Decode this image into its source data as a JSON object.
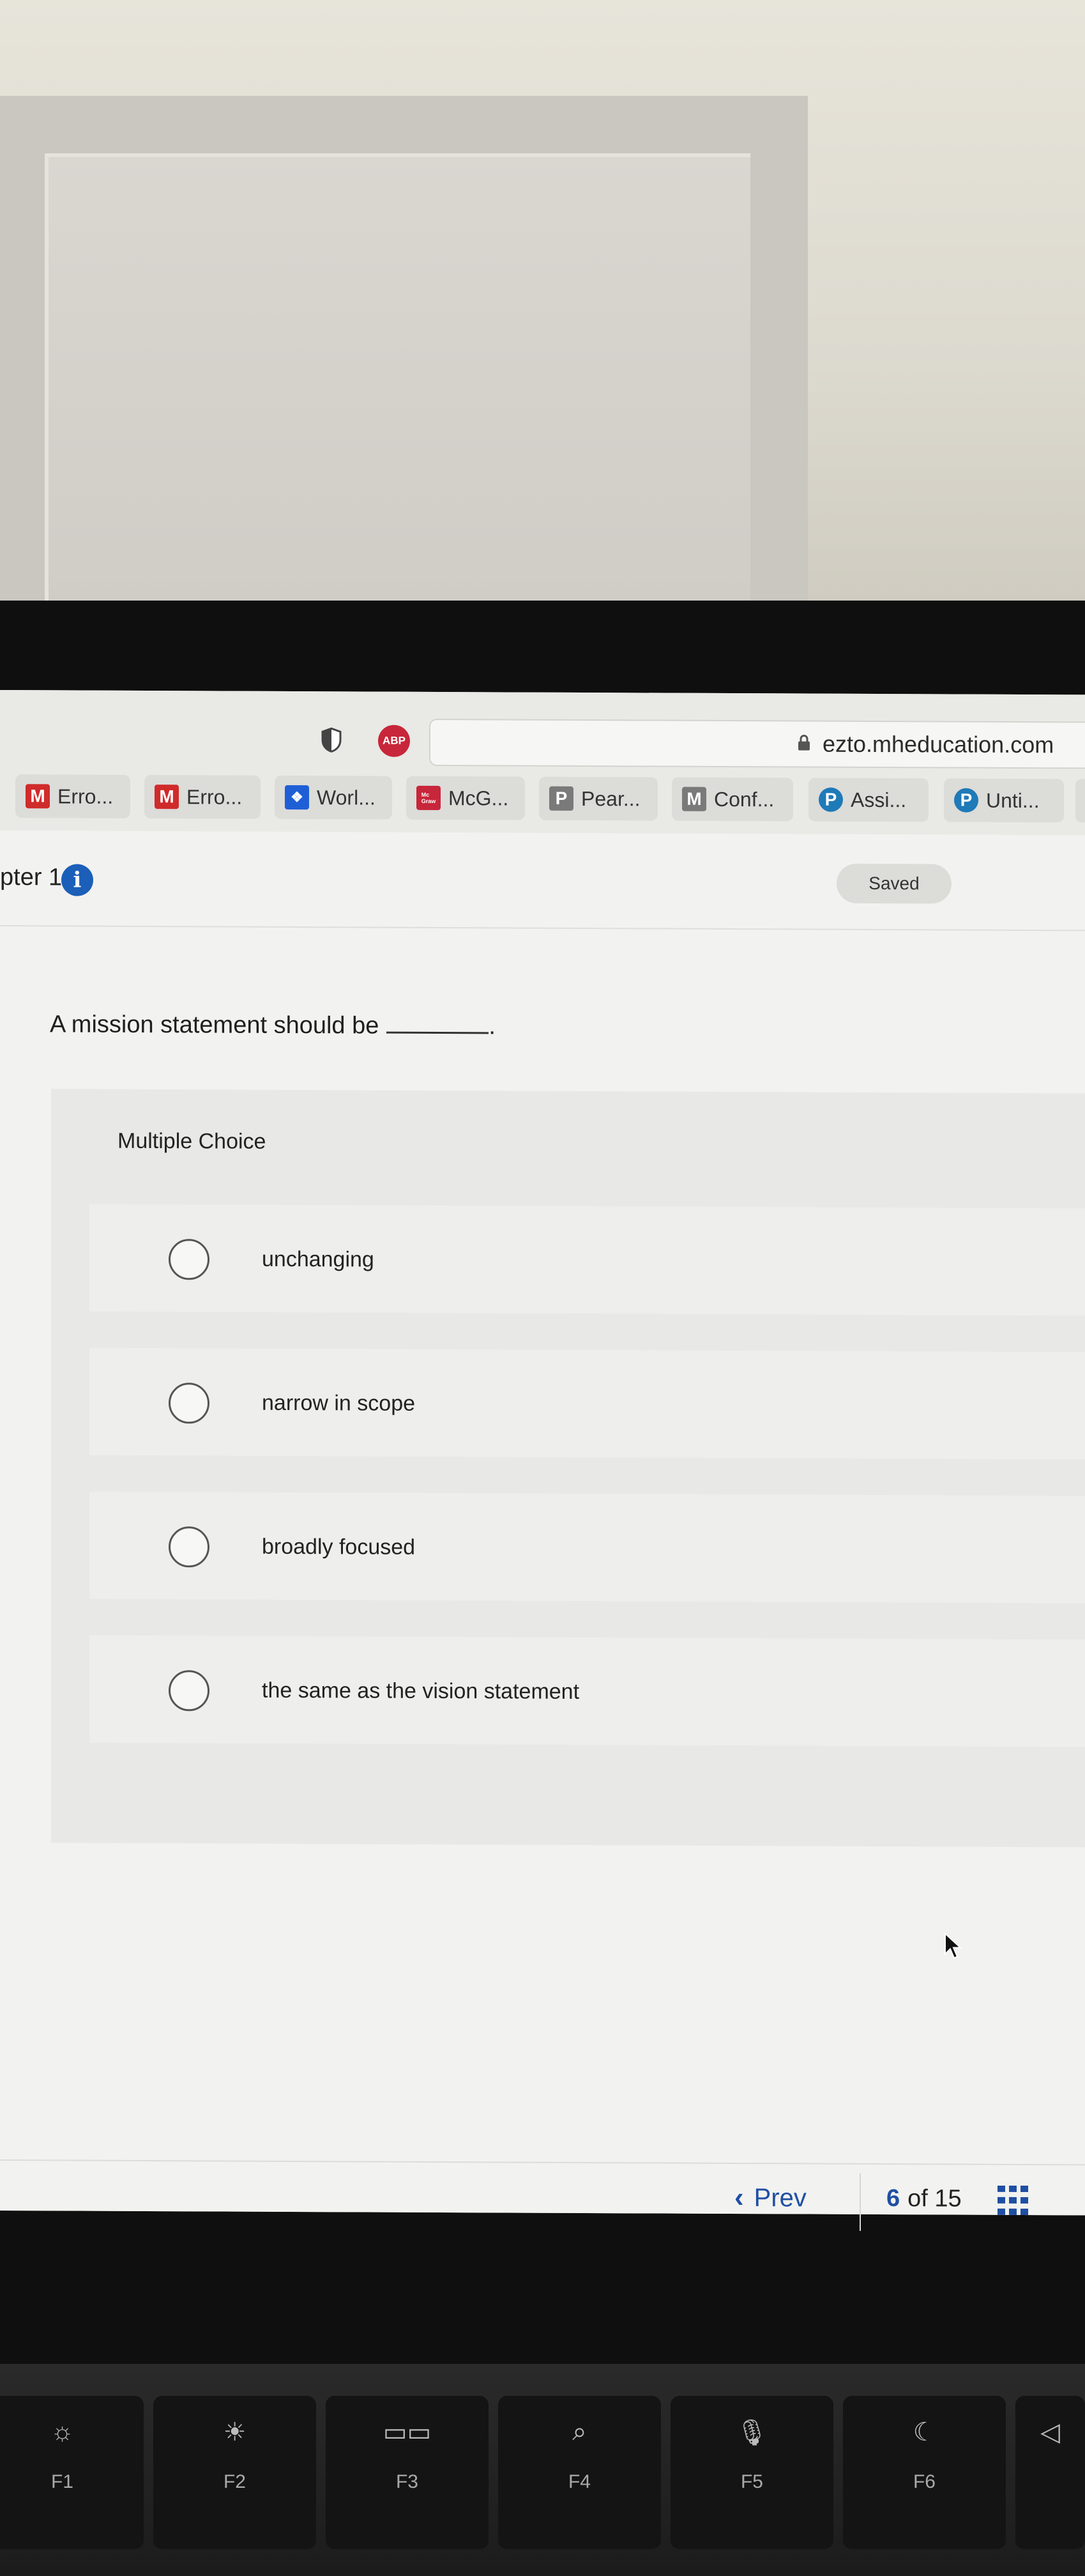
{
  "browser": {
    "url": "ezto.mheducation.com",
    "abp_label": "ABP",
    "tabs": [
      {
        "label": "Erro...",
        "icon": "M",
        "color": "#d02b2b"
      },
      {
        "label": "Erro...",
        "icon": "M",
        "color": "#d02b2b"
      },
      {
        "label": "Worl...",
        "icon": "dropbox-icon",
        "color": "#1f5fd6"
      },
      {
        "label": "McG...",
        "icon": "mcgraw-hill-icon",
        "color": "#c8263a"
      },
      {
        "label": "Pear...",
        "icon": "P",
        "color": "#7a7a7a"
      },
      {
        "label": "Conf...",
        "icon": "M",
        "color": "#7a7a7a"
      },
      {
        "label": "Assi...",
        "icon": "pearson-icon",
        "color": "#1f7ab8"
      },
      {
        "label": "Unti...",
        "icon": "pearson-icon",
        "color": "#1f7ab8"
      }
    ]
  },
  "header": {
    "chapter": "pter 1",
    "info_glyph": "i",
    "status": "Saved"
  },
  "question": {
    "text": "A mission statement should be",
    "end_punct": "."
  },
  "multiple_choice": {
    "label": "Multiple Choice",
    "options": [
      "unchanging",
      "narrow in scope",
      "broadly focused",
      "the same as the vision statement"
    ]
  },
  "navigation": {
    "prev_label": "Prev",
    "current": "6",
    "of_total": "of 15"
  },
  "keyboard": {
    "keys": [
      {
        "label": "F1",
        "icon": "brightness-low-icon"
      },
      {
        "label": "F2",
        "icon": "brightness-high-icon"
      },
      {
        "label": "F3",
        "icon": "mission-control-icon"
      },
      {
        "label": "F4",
        "icon": "search-icon"
      },
      {
        "label": "F5",
        "icon": "microphone-icon"
      },
      {
        "label": "F6",
        "icon": "moon-icon"
      }
    ]
  }
}
